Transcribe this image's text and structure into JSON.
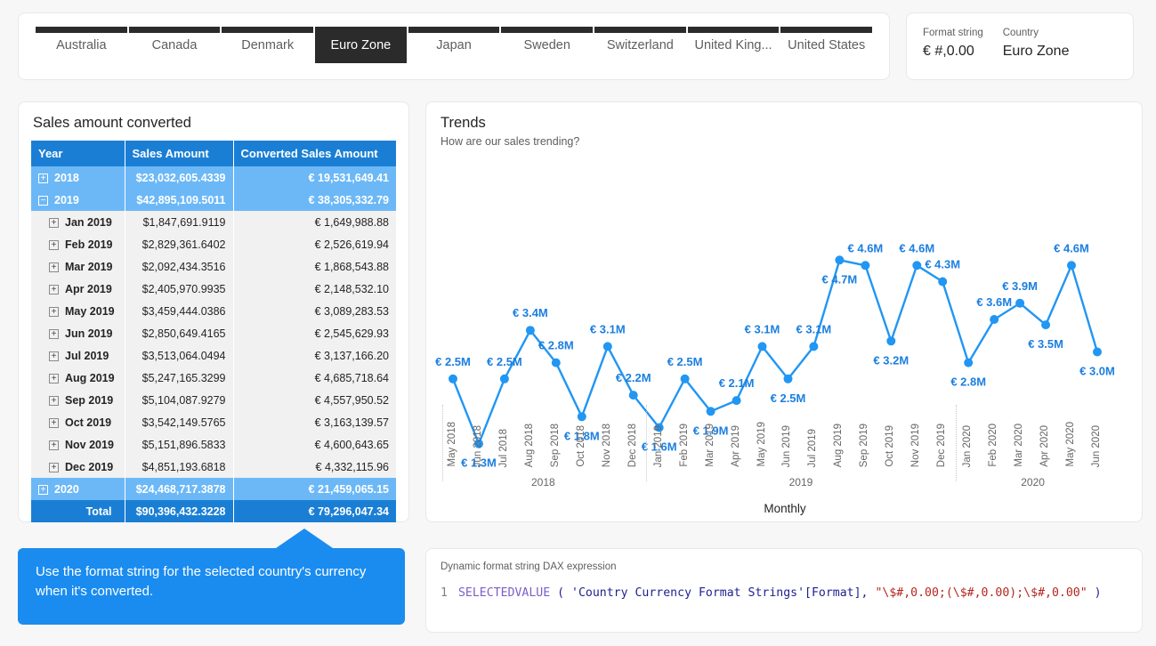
{
  "tabs": [
    {
      "label": "Australia",
      "selected": false
    },
    {
      "label": "Canada",
      "selected": false
    },
    {
      "label": "Denmark",
      "selected": false
    },
    {
      "label": "Euro Zone",
      "selected": true
    },
    {
      "label": "Japan",
      "selected": false
    },
    {
      "label": "Sweden",
      "selected": false
    },
    {
      "label": "Switzerland",
      "selected": false
    },
    {
      "label": "United King...",
      "selected": false
    },
    {
      "label": "United States",
      "selected": false
    }
  ],
  "format_card": {
    "format_label": "Format string",
    "format_value": "€ #,0.00",
    "country_label": "Country",
    "country_value": "Euro Zone"
  },
  "table": {
    "title": "Sales amount converted",
    "columns": [
      "Year",
      "Sales Amount",
      "Converted Sales Amount"
    ],
    "rows": [
      {
        "level": 1,
        "icon": "plus",
        "label": "2018",
        "sales": "$23,032,605.4339",
        "converted": "€ 19,531,649.41"
      },
      {
        "level": 1,
        "icon": "minus",
        "label": "2019",
        "sales": "$42,895,109.5011",
        "converted": "€ 38,305,332.79"
      },
      {
        "level": 2,
        "icon": "plus",
        "label": "Jan 2019",
        "sales": "$1,847,691.9119",
        "converted": "€ 1,649,988.88"
      },
      {
        "level": 2,
        "icon": "plus",
        "label": "Feb 2019",
        "sales": "$2,829,361.6402",
        "converted": "€ 2,526,619.94"
      },
      {
        "level": 2,
        "icon": "plus",
        "label": "Mar 2019",
        "sales": "$2,092,434.3516",
        "converted": "€ 1,868,543.88"
      },
      {
        "level": 2,
        "icon": "plus",
        "label": "Apr 2019",
        "sales": "$2,405,970.9935",
        "converted": "€ 2,148,532.10"
      },
      {
        "level": 2,
        "icon": "plus",
        "label": "May 2019",
        "sales": "$3,459,444.0386",
        "converted": "€ 3,089,283.53"
      },
      {
        "level": 2,
        "icon": "plus",
        "label": "Jun 2019",
        "sales": "$2,850,649.4165",
        "converted": "€ 2,545,629.93"
      },
      {
        "level": 2,
        "icon": "plus",
        "label": "Jul 2019",
        "sales": "$3,513,064.0494",
        "converted": "€ 3,137,166.20"
      },
      {
        "level": 2,
        "icon": "plus",
        "label": "Aug 2019",
        "sales": "$5,247,165.3299",
        "converted": "€ 4,685,718.64"
      },
      {
        "level": 2,
        "icon": "plus",
        "label": "Sep 2019",
        "sales": "$5,104,087.9279",
        "converted": "€ 4,557,950.52"
      },
      {
        "level": 2,
        "icon": "plus",
        "label": "Oct 2019",
        "sales": "$3,542,149.5765",
        "converted": "€ 3,163,139.57"
      },
      {
        "level": 2,
        "icon": "plus",
        "label": "Nov 2019",
        "sales": "$5,151,896.5833",
        "converted": "€ 4,600,643.65"
      },
      {
        "level": 2,
        "icon": "plus",
        "label": "Dec 2019",
        "sales": "$4,851,193.6818",
        "converted": "€ 4,332,115.96"
      },
      {
        "level": 1,
        "icon": "plus",
        "label": "2020",
        "sales": "$24,468,717.3878",
        "converted": "€ 21,459,065.15"
      },
      {
        "level": 0,
        "icon": "none",
        "label": "Total",
        "sales": "$90,396,432.3228",
        "converted": "€ 79,296,047.34"
      }
    ]
  },
  "chart": {
    "title": "Trends",
    "subtitle": "How are our sales trending?"
  },
  "chart_data": {
    "type": "line",
    "title": "Trends",
    "subtitle": "How are our sales trending?",
    "xlabel": "Monthly",
    "ylabel": "",
    "grid": false,
    "legend": null,
    "line_color": "#2196f3",
    "ylim": [
      0,
      5.0
    ],
    "year_groups": [
      {
        "label": "2018",
        "count": 8
      },
      {
        "label": "2019",
        "count": 12
      },
      {
        "label": "2020",
        "count": 6
      }
    ],
    "categories": [
      "May 2018",
      "Jun 2018",
      "Jul 2018",
      "Aug 2018",
      "Sep 2018",
      "Oct 2018",
      "Nov 2018",
      "Dec 2018",
      "Jan 2019",
      "Feb 2019",
      "Mar 2019",
      "Apr 2019",
      "May 2019",
      "Jun 2019",
      "Jul 2019",
      "Aug 2019",
      "Sep 2019",
      "Oct 2019",
      "Nov 2019",
      "Dec 2019",
      "Jan 2020",
      "Feb 2020",
      "Mar 2020",
      "Apr 2020",
      "May 2020",
      "Jun 2020"
    ],
    "values": [
      2.5,
      1.3,
      2.5,
      3.4,
      2.8,
      1.8,
      3.1,
      2.2,
      1.6,
      2.5,
      1.9,
      2.1,
      3.1,
      2.5,
      3.1,
      4.7,
      4.6,
      3.2,
      4.6,
      4.3,
      2.8,
      3.6,
      3.9,
      3.5,
      4.6,
      3.0
    ],
    "labels": [
      "€ 2.5M",
      "€ 1.3M",
      "€ 2.5M",
      "€ 3.4M",
      "€ 2.8M",
      "€ 1.8M",
      "€ 3.1M",
      "€ 2.2M",
      "€ 1.6M",
      "€ 2.5M",
      "€ 1.9M",
      "€ 2.1M",
      "€ 3.1M",
      "€ 2.5M",
      "€ 3.1M",
      "€ 4.7M",
      "€ 4.6M",
      "€ 3.2M",
      "€ 4.6M",
      "€ 4.3M",
      "€ 2.8M",
      "€ 3.6M",
      "€ 3.9M",
      "€ 3.5M",
      "€ 4.6M",
      "€ 3.0M"
    ],
    "label_positions": [
      "above",
      "below",
      "above",
      "above",
      "above",
      "below",
      "above",
      "above",
      "below",
      "above",
      "below",
      "above",
      "above",
      "below",
      "above",
      "below",
      "above",
      "below",
      "above",
      "above",
      "below",
      "above",
      "above",
      "below",
      "above",
      "below"
    ]
  },
  "callout": {
    "text": "Use the format string for the selected country's currency when it's converted."
  },
  "dax": {
    "label": "Dynamic format string DAX expression",
    "line_number": "1",
    "function": "SELECTEDVALUE",
    "open_paren": "(",
    "table_column": "'Country Currency Format Strings'[Format],",
    "string_literal": "\"\\$#,0.00;(\\$#,0.00);\\$#,0.00\"",
    "close_paren": ")"
  }
}
